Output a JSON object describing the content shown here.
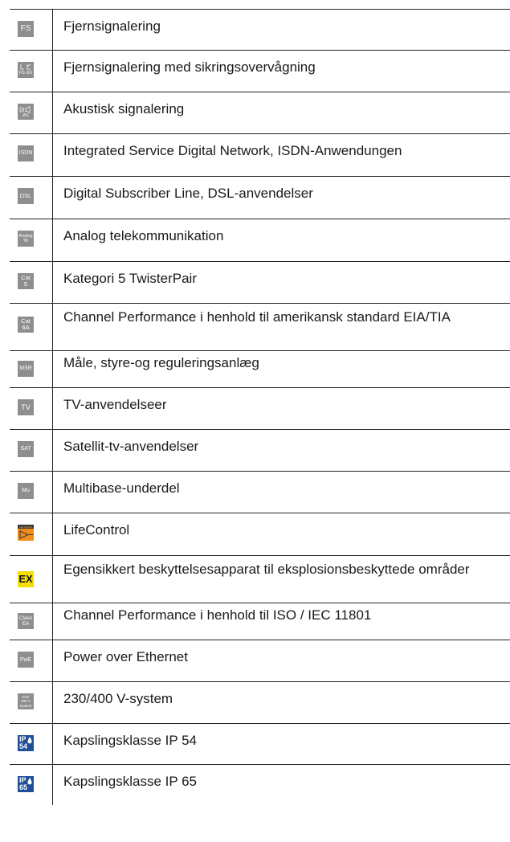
{
  "rows": [
    {
      "icon": "fs-icon",
      "badge": [
        "FS"
      ],
      "text": "Fjernsignalering"
    },
    {
      "icon": "fs-su-icon",
      "badge": [
        "FS-SÜ"
      ],
      "text": "Fjernsignalering med sikringsovervågning"
    },
    {
      "icon": "as-speaker-icon",
      "badge": [
        "AS"
      ],
      "text": "Akustisk signalering"
    },
    {
      "icon": "isdn-icon",
      "badge": [
        "ISDN"
      ],
      "text": "Integrated Service Digital Network, ISDN-Anwendungen"
    },
    {
      "icon": "dsl-icon",
      "badge": [
        "DSL"
      ],
      "text": "Digital Subscriber Line, DSL-anvendelser"
    },
    {
      "icon": "analog-tk-icon",
      "badge": [
        "Analog",
        "TK"
      ],
      "text": "Analog telekommunikation"
    },
    {
      "icon": "cat5-icon",
      "badge": [
        "Cat",
        "5"
      ],
      "text": "Kategori 5 TwisterPair"
    },
    {
      "icon": "cat6a-icon",
      "badge": [
        "Cat",
        "6A"
      ],
      "text": "Channel Performance i henhold til amerikansk standard EIA/TIA"
    },
    {
      "icon": "msr-icon",
      "badge": [
        "MSR"
      ],
      "text": "Måle, styre-og reguleringsanlæg"
    },
    {
      "icon": "tv-icon",
      "badge": [
        "TV"
      ],
      "text": "TV-anvendelseer"
    },
    {
      "icon": "sat-icon",
      "badge": [
        "SAT"
      ],
      "text": "Satellit-tv-anvendelser"
    },
    {
      "icon": "mu-icon",
      "badge": [
        "Mu"
      ],
      "text": "Multibase-underdel"
    },
    {
      "icon": "lifecontrol-icon",
      "badge": [
        "Life Control"
      ],
      "text": "LifeControl"
    },
    {
      "icon": "ex-icon",
      "badge": [
        "EX"
      ],
      "text": "Egensikkert beskyttelsesapparat til eksplosionsbeskyttede områder"
    },
    {
      "icon": "class-ea-icon",
      "badge": [
        "Class",
        "EA"
      ],
      "text": "Channel Performance i henhold til ISO / IEC 11801"
    },
    {
      "icon": "poe-icon",
      "badge": [
        "PoE"
      ],
      "text": "Power over Ethernet"
    },
    {
      "icon": "230-400v-system-icon",
      "badge": [
        "230/",
        "400 V",
        "System"
      ],
      "text": "230/400 V-system"
    },
    {
      "icon": "ip54-icon",
      "badge": [
        "IP",
        "54"
      ],
      "text": "Kapslingsklasse IP 54"
    },
    {
      "icon": "ip65-icon",
      "badge": [
        "IP",
        "65"
      ],
      "text": "Kapslingsklasse IP 65"
    }
  ]
}
